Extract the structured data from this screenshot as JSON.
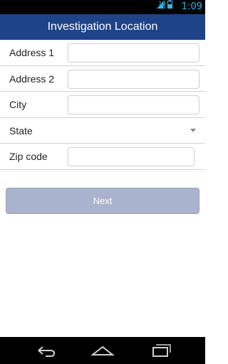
{
  "status_bar": {
    "network_type": "3G",
    "time": "1:09",
    "accent_color": "#33b5e5",
    "icons": [
      "signal-icon",
      "battery-icon"
    ]
  },
  "app_bar": {
    "title": "Investigation Location",
    "background_color": "#1f4387"
  },
  "form": {
    "fields": [
      {
        "label": "Address 1",
        "value": "",
        "type": "text"
      },
      {
        "label": "Address 2",
        "value": "",
        "type": "text"
      },
      {
        "label": "City",
        "value": "",
        "type": "text"
      },
      {
        "label": "State",
        "value": "",
        "type": "select"
      },
      {
        "label": "Zip code",
        "value": "",
        "type": "text"
      }
    ]
  },
  "next_button": {
    "label": "Next",
    "color": "#a9b3cd"
  },
  "nav_bar": {
    "icons": [
      "back-icon",
      "home-icon",
      "recent-apps-icon"
    ]
  }
}
